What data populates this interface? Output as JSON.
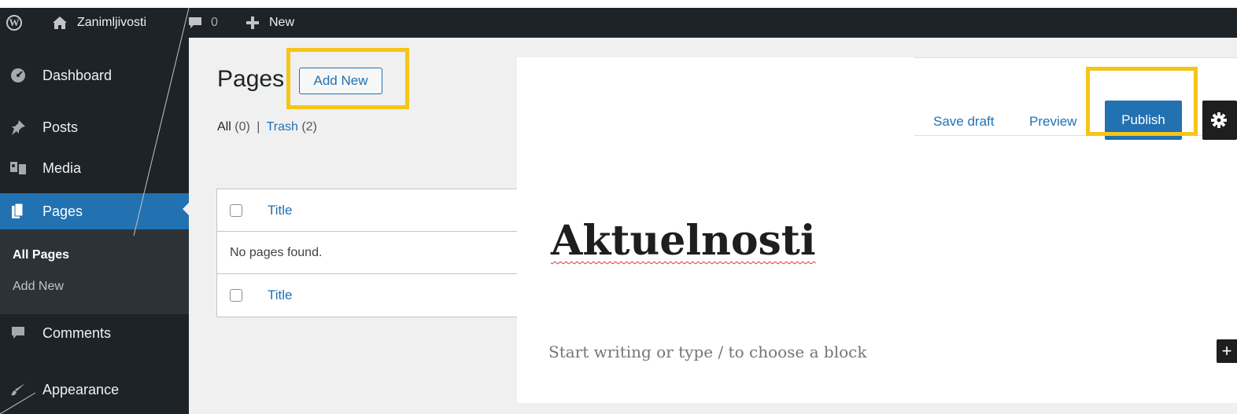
{
  "adminbar": {
    "site_name": "Zanimljivosti",
    "comments_count": "0",
    "new_label": "New"
  },
  "sidebar": {
    "items": [
      {
        "label": "Dashboard",
        "icon": "dashboard-icon"
      },
      {
        "label": "Posts",
        "icon": "pushpin-icon"
      },
      {
        "label": "Media",
        "icon": "media-icon"
      },
      {
        "label": "Pages",
        "icon": "pages-icon"
      },
      {
        "label": "Comments",
        "icon": "comment-icon"
      },
      {
        "label": "Appearance",
        "icon": "paintbrush-icon"
      }
    ],
    "submenu": [
      {
        "label": "All Pages"
      },
      {
        "label": "Add New"
      }
    ]
  },
  "pages": {
    "title": "Pages",
    "add_new": "Add New",
    "filters": {
      "all_label": "All",
      "all_count": "(0)",
      "separator": "|",
      "trash_label": "Trash",
      "trash_count": "(2)"
    },
    "table": {
      "header_title": "Title",
      "empty_message": "No pages found.",
      "footer_title": "Title"
    }
  },
  "editor": {
    "save_draft": "Save draft",
    "preview": "Preview",
    "publish": "Publish",
    "post_title": "Aktuelnosti",
    "block_placeholder": "Start writing or type / to choose a block",
    "inserter_label": "+"
  },
  "colors": {
    "admin_dark": "#1d2327",
    "wp_blue": "#2271b1",
    "highlight_yellow": "#f5c518"
  }
}
